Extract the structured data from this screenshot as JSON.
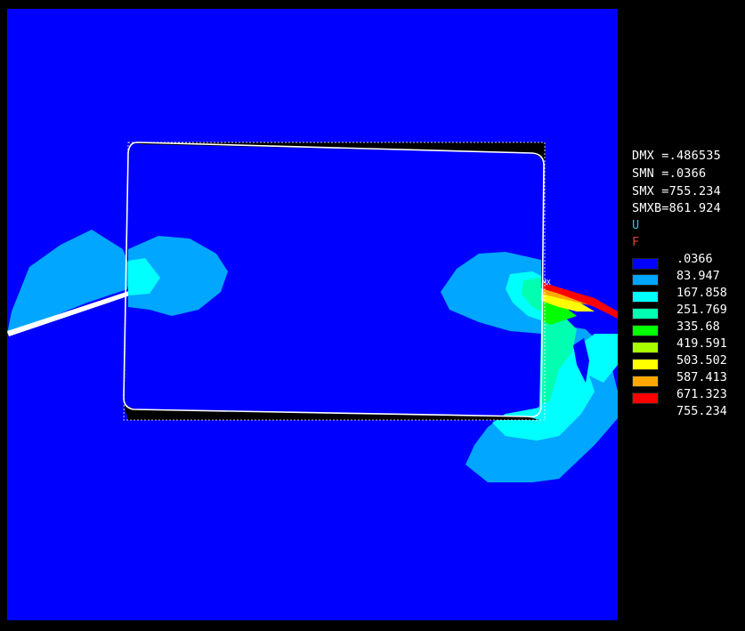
{
  "header_lines": [
    "",
    "",
    "",
    "",
    "",
    "",
    "",
    "",
    ""
  ],
  "stats": [
    {
      "key": "DMX",
      "text": "DMX =.486535"
    },
    {
      "key": "SMN",
      "text": "SMN =.0366"
    },
    {
      "key": "SMX",
      "text": "SMX =755.234"
    },
    {
      "key": "SMXB",
      "text": "SMXB=861.924"
    }
  ],
  "symbols": {
    "u": "U",
    "f": "F"
  },
  "node_label": "MX",
  "legend": [
    {
      "value": ".0366",
      "color": "#0000ff"
    },
    {
      "value": "83.947",
      "color": "#00a6ff"
    },
    {
      "value": "167.858",
      "color": "#00ffff"
    },
    {
      "value": "251.769",
      "color": "#00ffb0"
    },
    {
      "value": "335.68",
      "color": "#00ff00"
    },
    {
      "value": "419.591",
      "color": "#a8ff00"
    },
    {
      "value": "503.502",
      "color": "#ffff00"
    },
    {
      "value": "587.413",
      "color": "#ffa800"
    },
    {
      "value": "671.323",
      "color": "#ff0000"
    },
    {
      "value": "755.234",
      "color": "#ff0000"
    }
  ],
  "colors": {
    "background": "#000000",
    "viewport": "#0000ff",
    "band1": "#00a6ff",
    "band2": "#00ffff",
    "band3": "#00ffb0",
    "band4": "#00ff00",
    "band5": "#ffff00",
    "band6": "#ffa800",
    "band7": "#ff0000",
    "edge": "#ffffff"
  }
}
